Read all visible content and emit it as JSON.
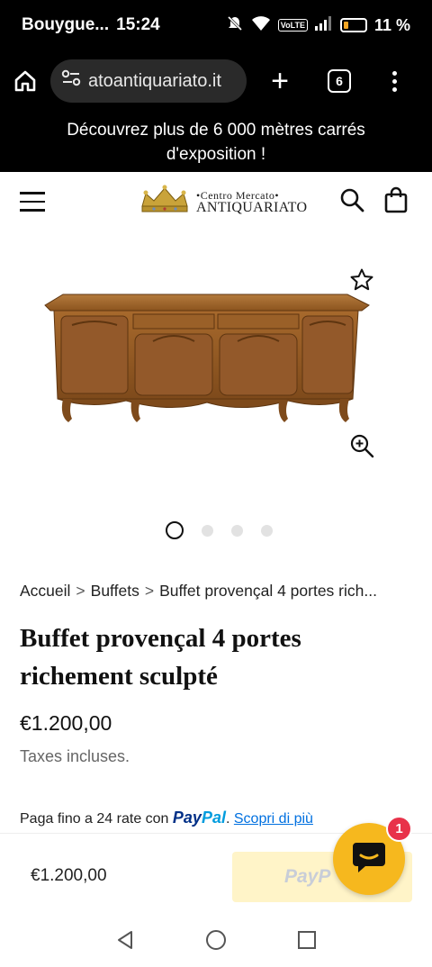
{
  "status_bar": {
    "carrier": "Bouygue...",
    "time": "15:24",
    "volte": "VoLTE",
    "battery": "11 %"
  },
  "browser": {
    "url": "atoantiquariato.it",
    "tab_count": "6"
  },
  "announcement": {
    "text": "Découvrez plus de 6 000 mètres carrés d'exposition !"
  },
  "header": {
    "logo_line1": "•Centro Mercato•",
    "logo_line2": "ANTIQUARIATO"
  },
  "gallery": {
    "image_count": 4,
    "active_index": 0
  },
  "breadcrumb": {
    "items": [
      "Accueil",
      "Buffets",
      "Buffet provençal 4 portes rich..."
    ],
    "separator": ">"
  },
  "product": {
    "title": "Buffet provençal 4 portes richement sculpté",
    "price": "€1.200,00",
    "taxes": "Taxes incluses."
  },
  "paypal": {
    "message_prefix": "Paga fino a 24 rate con",
    "logo_pay": "Pay",
    "logo_pal": "Pal",
    "period": ".",
    "learn_more": "Scopri di più"
  },
  "sticky_bar": {
    "price": "€1.200,00",
    "button_label": "PayP"
  },
  "chat": {
    "badge_count": "1"
  },
  "colors": {
    "chat_bg": "#f6b81e",
    "badge_bg": "#e8324a",
    "paypal_blue_dark": "#003087",
    "paypal_blue_light": "#009cde",
    "paypal_button_bg": "#fff4c8"
  }
}
